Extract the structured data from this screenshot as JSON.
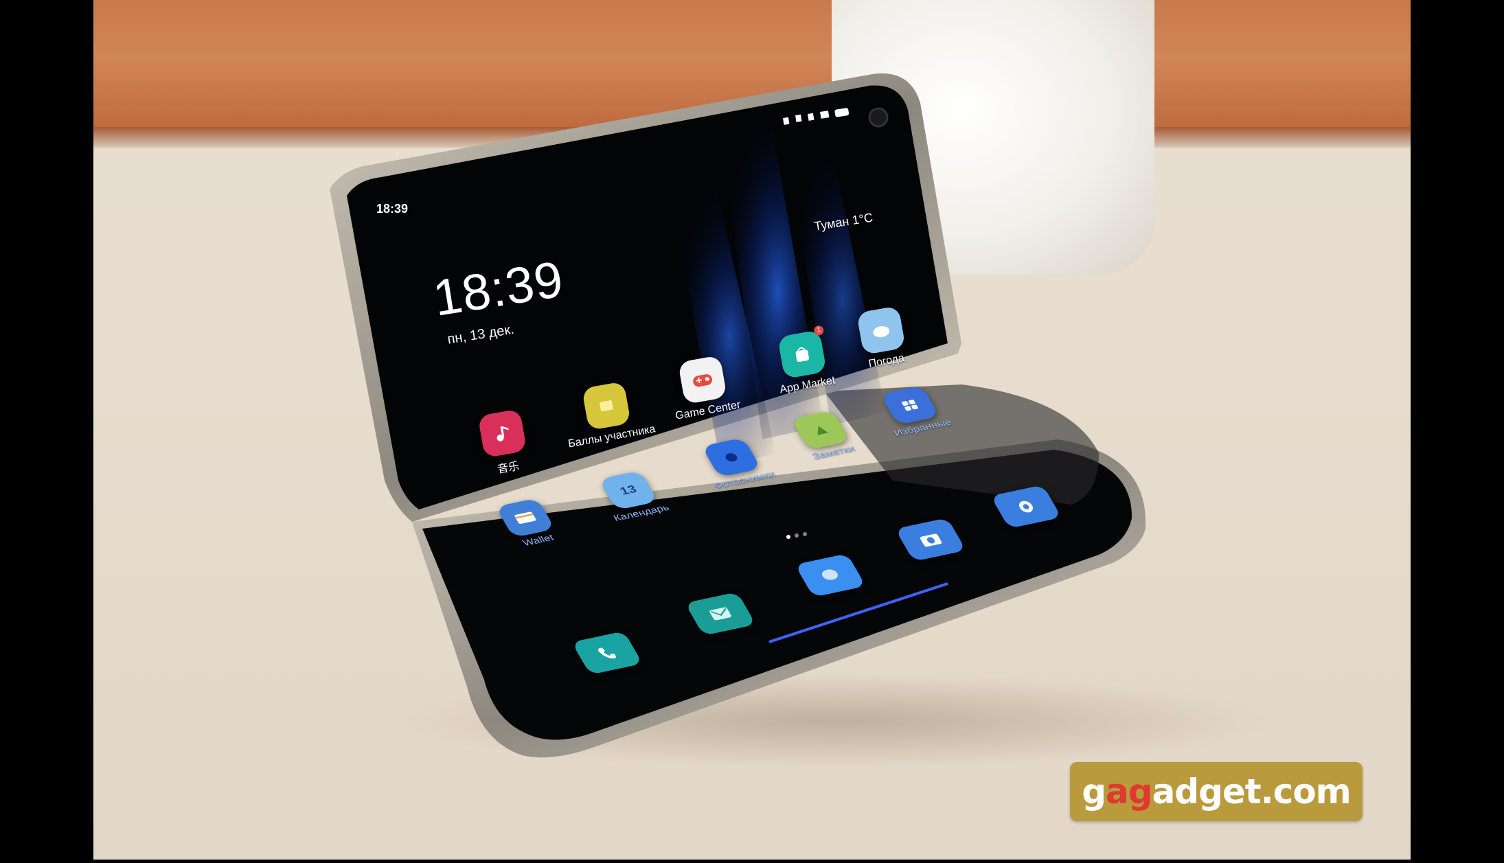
{
  "lock_screen": {
    "status_time": "18:39",
    "clock": "18:39",
    "date": "пн, 13 дек.",
    "weather": "Туман 1°C"
  },
  "apps_upper": [
    {
      "label": "音乐",
      "icon": "music-icon",
      "color": "#d8305a"
    },
    {
      "label": "Баллы участника",
      "icon": "rewards-icon",
      "color": "#d7c63a"
    },
    {
      "label": "Game Center",
      "icon": "game-center-icon",
      "color": "#f2f2f2"
    },
    {
      "label": "App Market",
      "icon": "app-market-icon",
      "color": "#1bb7a6"
    },
    {
      "label": "Погода",
      "icon": "weather-icon",
      "color": "#8fc4ee"
    }
  ],
  "apps_lower": [
    {
      "label": "Wallet",
      "icon": "wallet-icon",
      "color": "#3f7fd8"
    },
    {
      "label": "Календарь",
      "icon": "calendar-icon",
      "color": "#6fb2ec",
      "day": "13"
    },
    {
      "label": "Фотоснимки",
      "icon": "photos-icon",
      "color": "#2d6fe0"
    },
    {
      "label": "Заметки",
      "icon": "notes-icon",
      "color": "#9cc85a"
    },
    {
      "label": "Избранные",
      "icon": "favorites-icon",
      "color": "#3b6fd9"
    }
  ],
  "dock": [
    {
      "icon": "phone-icon",
      "color": "#1aa3a3"
    },
    {
      "icon": "messages-icon",
      "color": "#1a9d96"
    },
    {
      "icon": "chat-icon",
      "color": "#3a8ff0"
    },
    {
      "icon": "camera-icon",
      "color": "#3a7ee0"
    },
    {
      "icon": "settings-icon",
      "color": "#3a7ee0"
    }
  ],
  "watermark": {
    "prefix": "g",
    "accent": "a",
    "accent2": "g",
    "rest": "adget.com"
  }
}
